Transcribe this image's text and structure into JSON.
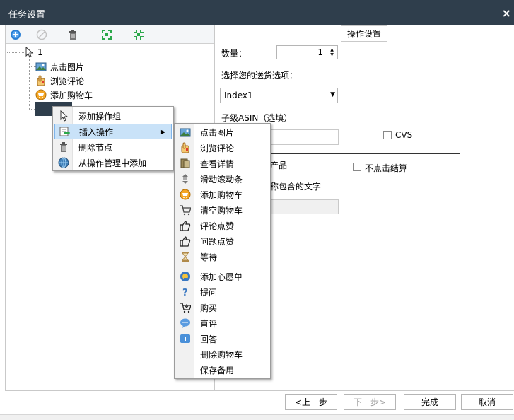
{
  "window": {
    "title": "任务设置",
    "close_label": "×"
  },
  "toolbar": {
    "icons": [
      "add-icon",
      "disabled-icon",
      "trash-icon",
      "expand-icon",
      "collapse-icon"
    ],
    "colors": {
      "add": "#2a7fd4",
      "expand": "#2aa84a"
    }
  },
  "tree": {
    "root_label": "1",
    "children": [
      {
        "label": "点击图片",
        "icon": "picture-icon"
      },
      {
        "label": "浏览评论",
        "icon": "hand-icon"
      },
      {
        "label": "添加购物车",
        "icon": "cart-add-icon"
      },
      {
        "label": "",
        "icon": "cursor-icon"
      }
    ]
  },
  "settings": {
    "group_caption": "操作设置",
    "quantity_label": "数量：",
    "quantity_value": "1",
    "shipping_label": "选择您的送货选项：",
    "shipping_value": "Index1",
    "asin_label": "子级ASIN（选填）",
    "cvs_label": "CVS",
    "product_label": "产品",
    "no_checkout_label": "不点击结算",
    "name_contains_label": "称包含的文字"
  },
  "context_menu": {
    "items": [
      {
        "label": "添加操作组",
        "icon": "cursor-icon"
      },
      {
        "label": "插入操作",
        "icon": "insert-icon",
        "submenu_arrow": "▶"
      },
      {
        "label": "删除节点",
        "icon": "trash-icon"
      },
      {
        "label": "从操作管理中添加",
        "icon": "globe-icon"
      }
    ]
  },
  "submenu": {
    "items": [
      {
        "label": "点击图片",
        "icon": "picture-icon"
      },
      {
        "label": "浏览评论",
        "icon": "hand-icon"
      },
      {
        "label": "查看详情",
        "icon": "book-icon"
      },
      {
        "label": "滑动滚动条",
        "icon": "scroll-icon"
      },
      {
        "label": "添加购物车",
        "icon": "cart-add-icon"
      },
      {
        "label": "清空购物车",
        "icon": "cart-empty-icon"
      },
      {
        "label": "评论点赞",
        "icon": "thumbs-up-icon"
      },
      {
        "label": "问题点赞",
        "icon": "thumbs-up-icon"
      },
      {
        "label": "等待",
        "icon": "hourglass-icon"
      },
      {
        "label": "添加心愿单",
        "icon": "wishlist-icon"
      },
      {
        "label": "提问",
        "icon": "question-icon"
      },
      {
        "label": "购买",
        "icon": "buy-cart-icon"
      },
      {
        "label": "直评",
        "icon": "chat-icon"
      },
      {
        "label": "回答",
        "icon": "answer-icon"
      },
      {
        "label": "删除购物车",
        "icon": ""
      },
      {
        "label": "保存备用",
        "icon": ""
      }
    ]
  },
  "footer": {
    "prev_label": "<上一步",
    "next_label": "下一步>",
    "finish_label": "完成",
    "cancel_label": "取消"
  }
}
